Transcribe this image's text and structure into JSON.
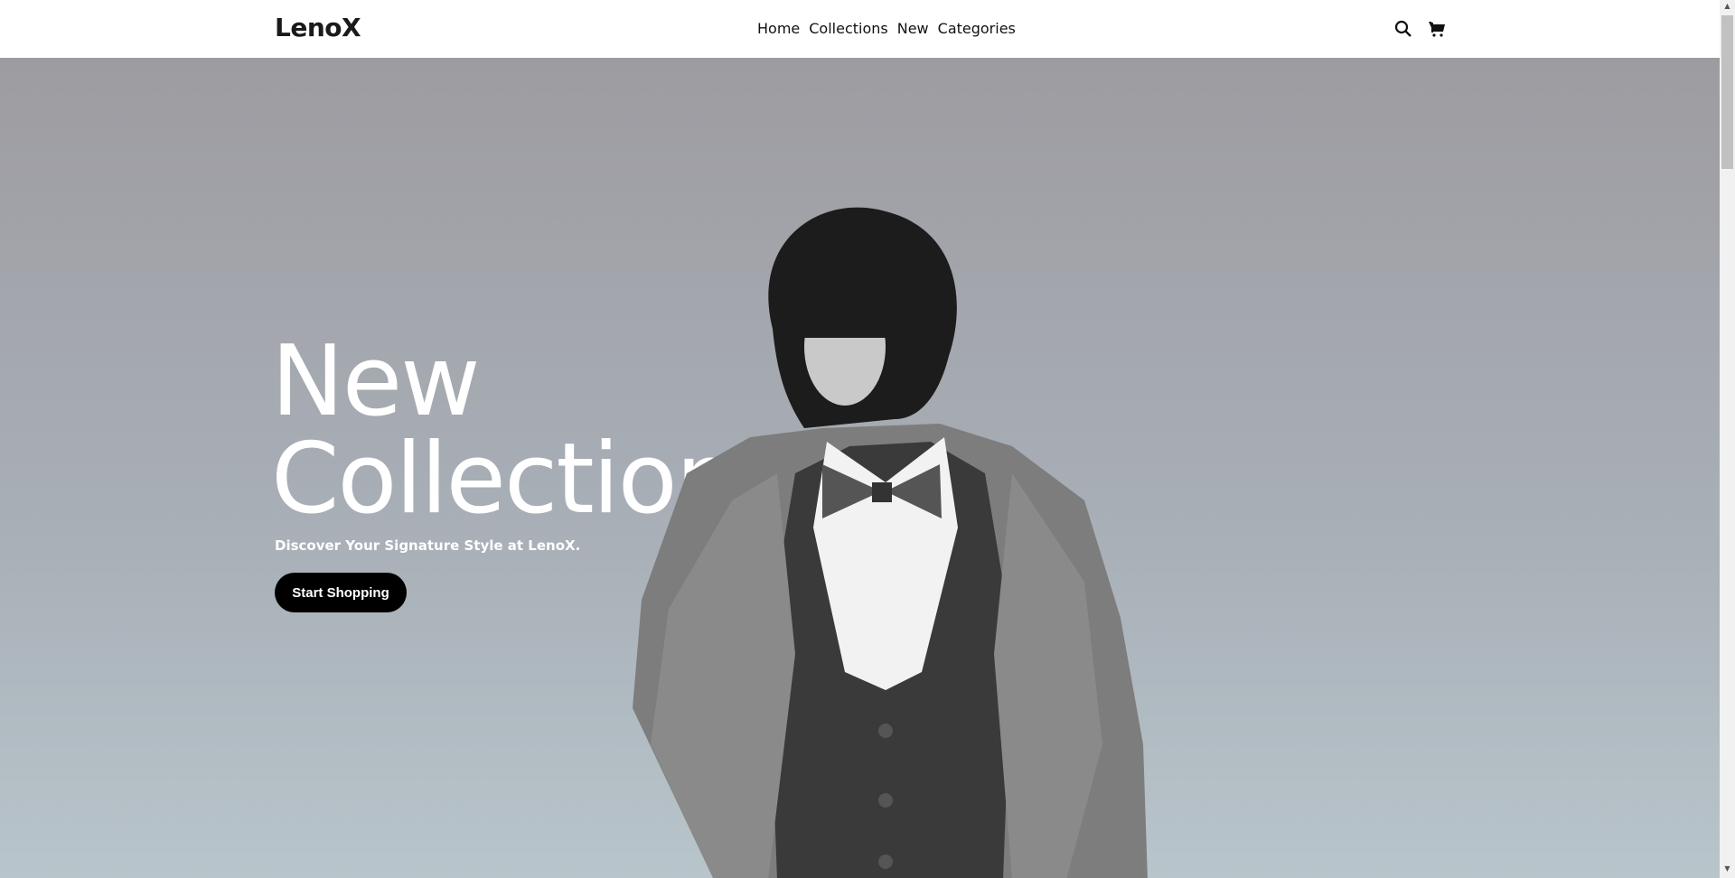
{
  "header": {
    "logo": "LenoX",
    "nav": [
      {
        "label": "Home"
      },
      {
        "label": "Collections"
      },
      {
        "label": "New"
      },
      {
        "label": "Categories"
      }
    ],
    "icons": [
      "search-icon",
      "cart-icon"
    ]
  },
  "hero": {
    "title_line1": "New",
    "title_line2": "Collection",
    "subtitle": "Discover Your Signature Style at LenoX.",
    "cta": "Start Shopping",
    "image": "black-and-white model in blazer and bow tie",
    "colors": {
      "bg_top": "#9d9ca1",
      "bg_bottom": "#b8c5cb",
      "button": "#000000"
    }
  }
}
